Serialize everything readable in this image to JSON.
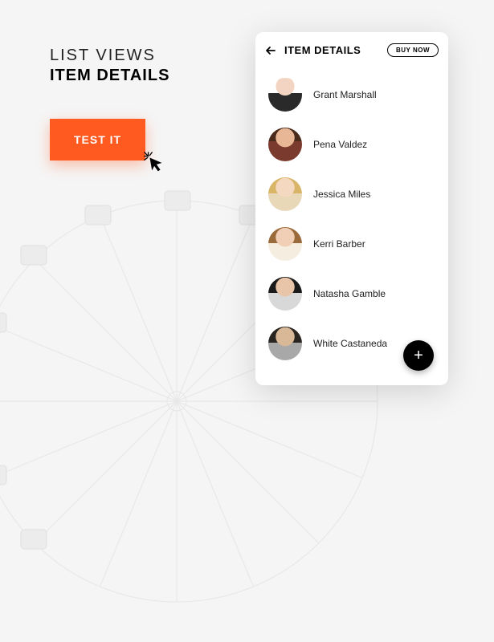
{
  "heading": {
    "line1": "LIST VIEWS",
    "line2": "ITEM DETAILS"
  },
  "cta": {
    "label": "TEST IT"
  },
  "phone": {
    "title": "ITEM DETAILS",
    "buy_label": "BUY NOW",
    "items": [
      {
        "name": "Grant Marshall"
      },
      {
        "name": "Pena Valdez"
      },
      {
        "name": "Jessica Miles"
      },
      {
        "name": "Kerri Barber"
      },
      {
        "name": "Natasha Gamble"
      },
      {
        "name": "White Castaneda"
      }
    ],
    "fab_label": "+"
  }
}
